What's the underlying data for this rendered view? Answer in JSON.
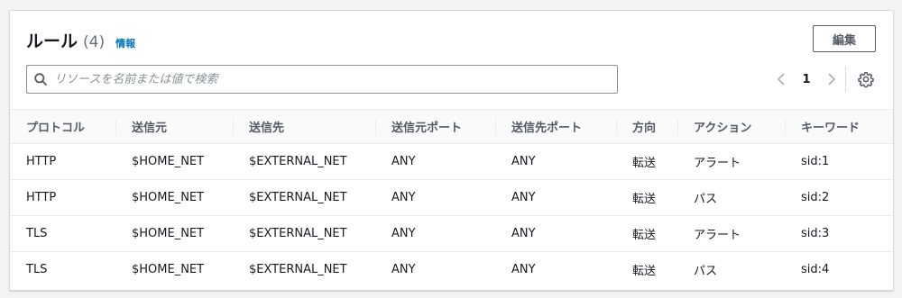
{
  "header": {
    "title": "ルール",
    "count": "(4)",
    "info_link": "情報",
    "edit_label": "編集"
  },
  "search": {
    "placeholder": "リソースを名前または値で検索",
    "value": ""
  },
  "pagination": {
    "current_page": "1"
  },
  "icons": {
    "search": "search-icon",
    "prev": "chevron-left-icon",
    "next": "chevron-right-icon",
    "settings": "gear-icon"
  },
  "colors": {
    "link": "#0073bb",
    "border": "#d5dbdb",
    "header_text": "#545b64"
  },
  "table": {
    "columns": [
      "プロトコル",
      "送信元",
      "送信先",
      "送信元ポート",
      "送信先ポート",
      "方向",
      "アクション",
      "キーワード"
    ],
    "rows": [
      [
        "HTTP",
        "$HOME_NET",
        "$EXTERNAL_NET",
        "ANY",
        "ANY",
        "転送",
        "アラート",
        "sid:1"
      ],
      [
        "HTTP",
        "$HOME_NET",
        "$EXTERNAL_NET",
        "ANY",
        "ANY",
        "転送",
        "パス",
        "sid:2"
      ],
      [
        "TLS",
        "$HOME_NET",
        "$EXTERNAL_NET",
        "ANY",
        "ANY",
        "転送",
        "アラート",
        "sid:3"
      ],
      [
        "TLS",
        "$HOME_NET",
        "$EXTERNAL_NET",
        "ANY",
        "ANY",
        "転送",
        "パス",
        "sid:4"
      ]
    ]
  }
}
